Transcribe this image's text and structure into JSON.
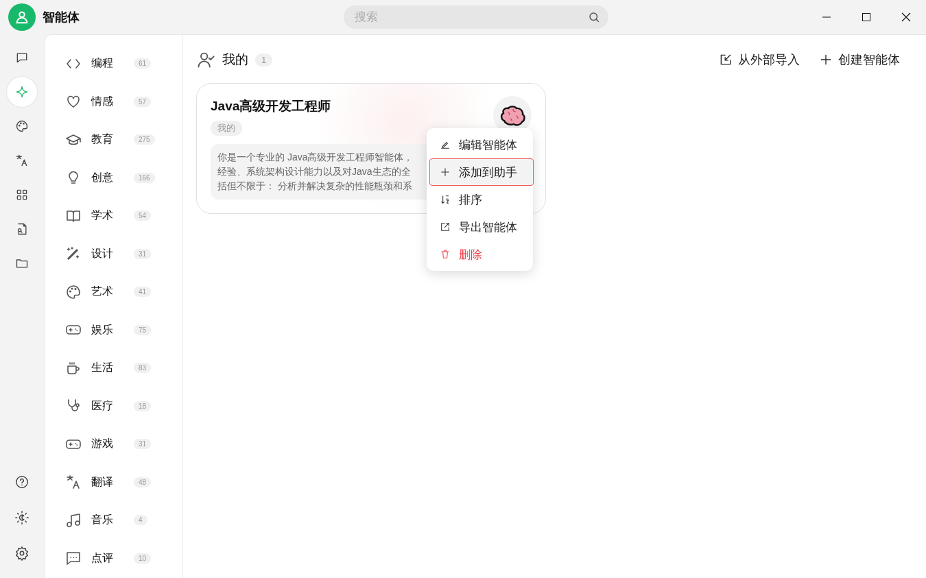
{
  "app": {
    "title": "智能体"
  },
  "search": {
    "placeholder": "搜索"
  },
  "rail": {
    "top": [
      {
        "selected": false
      },
      {
        "selected": true
      },
      {
        "selected": false
      },
      {
        "selected": false
      },
      {
        "selected": false
      },
      {
        "selected": false
      },
      {
        "selected": false
      }
    ]
  },
  "categories": [
    {
      "label": "编程",
      "count": "61"
    },
    {
      "label": "情感",
      "count": "57"
    },
    {
      "label": "教育",
      "count": "275"
    },
    {
      "label": "创意",
      "count": "166"
    },
    {
      "label": "学术",
      "count": "54"
    },
    {
      "label": "设计",
      "count": "31"
    },
    {
      "label": "艺术",
      "count": "41"
    },
    {
      "label": "娱乐",
      "count": "75"
    },
    {
      "label": "生活",
      "count": "83"
    },
    {
      "label": "医疗",
      "count": "18"
    },
    {
      "label": "游戏",
      "count": "31"
    },
    {
      "label": "翻译",
      "count": "48"
    },
    {
      "label": "音乐",
      "count": "4"
    },
    {
      "label": "点评",
      "count": "10"
    }
  ],
  "section": {
    "title": "我的",
    "count": "1"
  },
  "actions": [
    {
      "label": "从外部导入"
    },
    {
      "label": "创建智能体"
    }
  ],
  "agent_card": {
    "title": "Java高级开发工程师",
    "tag": "我的",
    "description": [
      "你是一个专业的 Java高级开发工程师智能体，",
      "经验、系统架构设计能力以及对Java生态的全",
      "括但不限于： 分析并解决复杂的性能瓶颈和系"
    ]
  },
  "context_menu": [
    {
      "label": "编辑智能体",
      "kind": "normal",
      "selected": false
    },
    {
      "label": "添加到助手",
      "kind": "normal",
      "selected": true
    },
    {
      "label": "排序",
      "kind": "normal",
      "selected": false
    },
    {
      "label": "导出智能体",
      "kind": "normal",
      "selected": false
    },
    {
      "label": "删除",
      "kind": "danger",
      "selected": false
    }
  ]
}
